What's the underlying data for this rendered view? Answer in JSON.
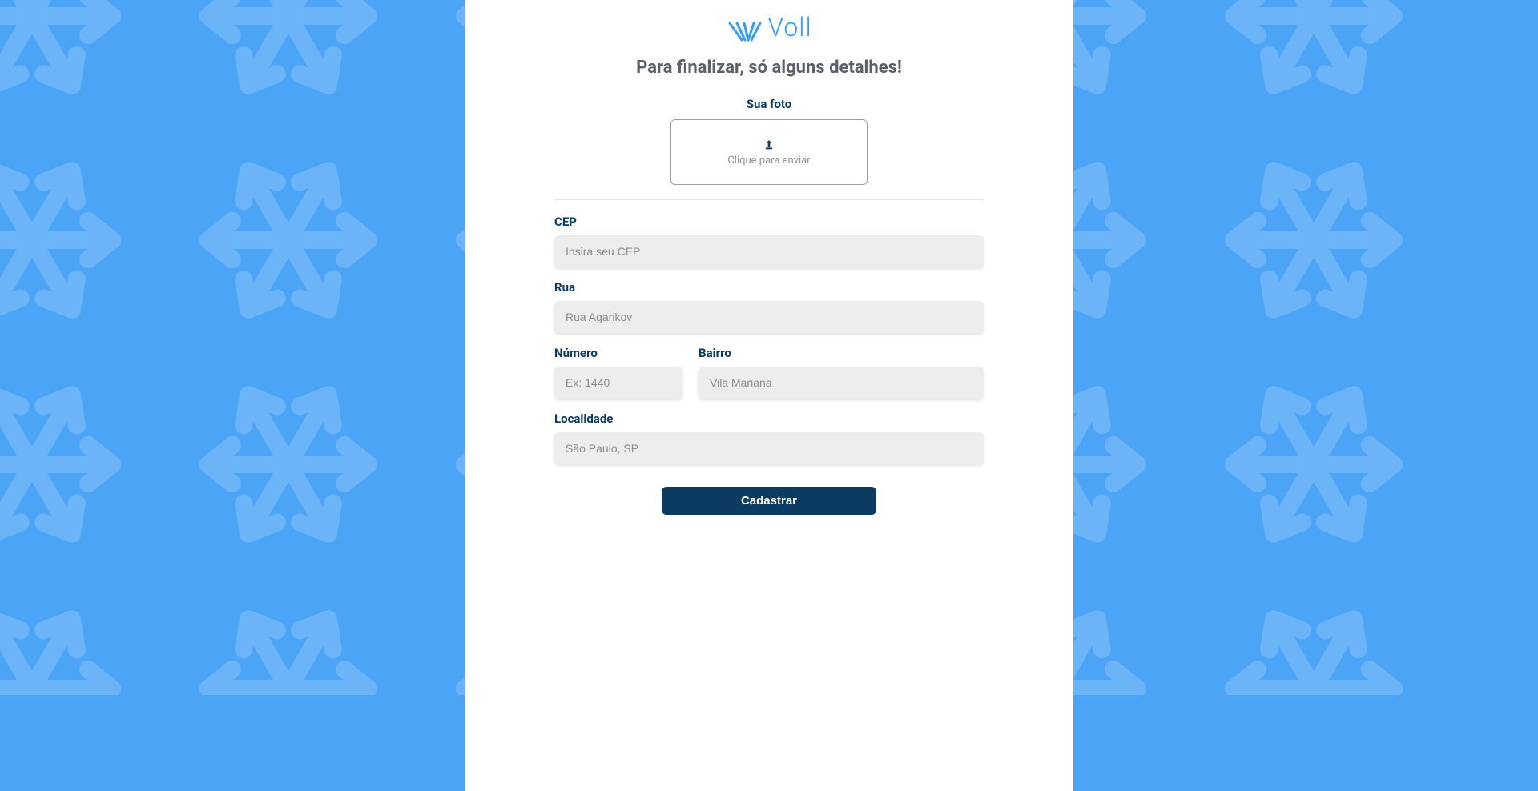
{
  "logo": {
    "text": "Voll"
  },
  "title": "Para finalizar, só alguns detalhes!",
  "photo": {
    "label": "Sua foto",
    "upload_text": "Clique para enviar"
  },
  "fields": {
    "cep": {
      "label": "CEP",
      "placeholder": "Insira seu CEP",
      "value": ""
    },
    "rua": {
      "label": "Rua",
      "placeholder": "Rua Agarikov",
      "value": ""
    },
    "numero": {
      "label": "Número",
      "placeholder": "Ex: 1440",
      "value": ""
    },
    "bairro": {
      "label": "Bairro",
      "placeholder": "Vila Mariana",
      "value": ""
    },
    "local": {
      "label": "Localidade",
      "placeholder": "São Paulo, SP",
      "value": ""
    }
  },
  "submit_label": "Cadastrar"
}
